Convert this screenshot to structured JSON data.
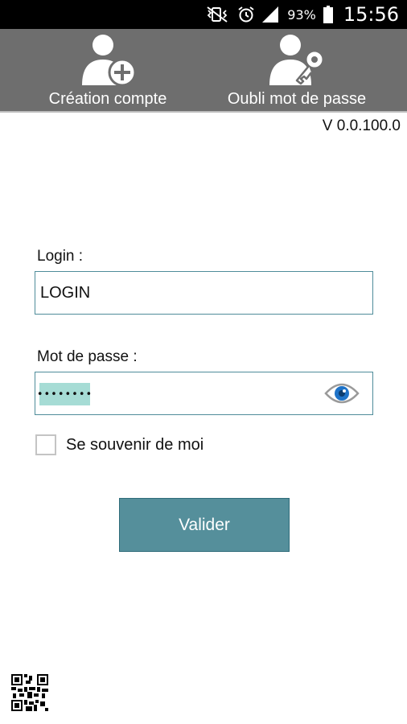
{
  "status_bar": {
    "battery_percent": "93%",
    "time": "15:56",
    "icons": [
      "mute-vibrate-icon",
      "alarm-icon",
      "signal-icon",
      "battery-icon"
    ]
  },
  "toolbar": {
    "create_account_label": "Création compte",
    "forgot_password_label": "Oubli mot de passe",
    "icons": [
      "user-add-icon",
      "user-key-icon"
    ]
  },
  "version": "V 0.0.100.0",
  "form": {
    "login_label": "Login :",
    "login_value": "LOGIN",
    "password_label": "Mot de passe :",
    "password_mask": "••••••••",
    "remember_label": "Se souvenir de moi",
    "remember_checked": false,
    "submit_label": "Valider"
  },
  "colors": {
    "toolbar_bg": "#6e6e6e",
    "accent": "#558f9b",
    "password_highlight": "#a6dcd5"
  }
}
